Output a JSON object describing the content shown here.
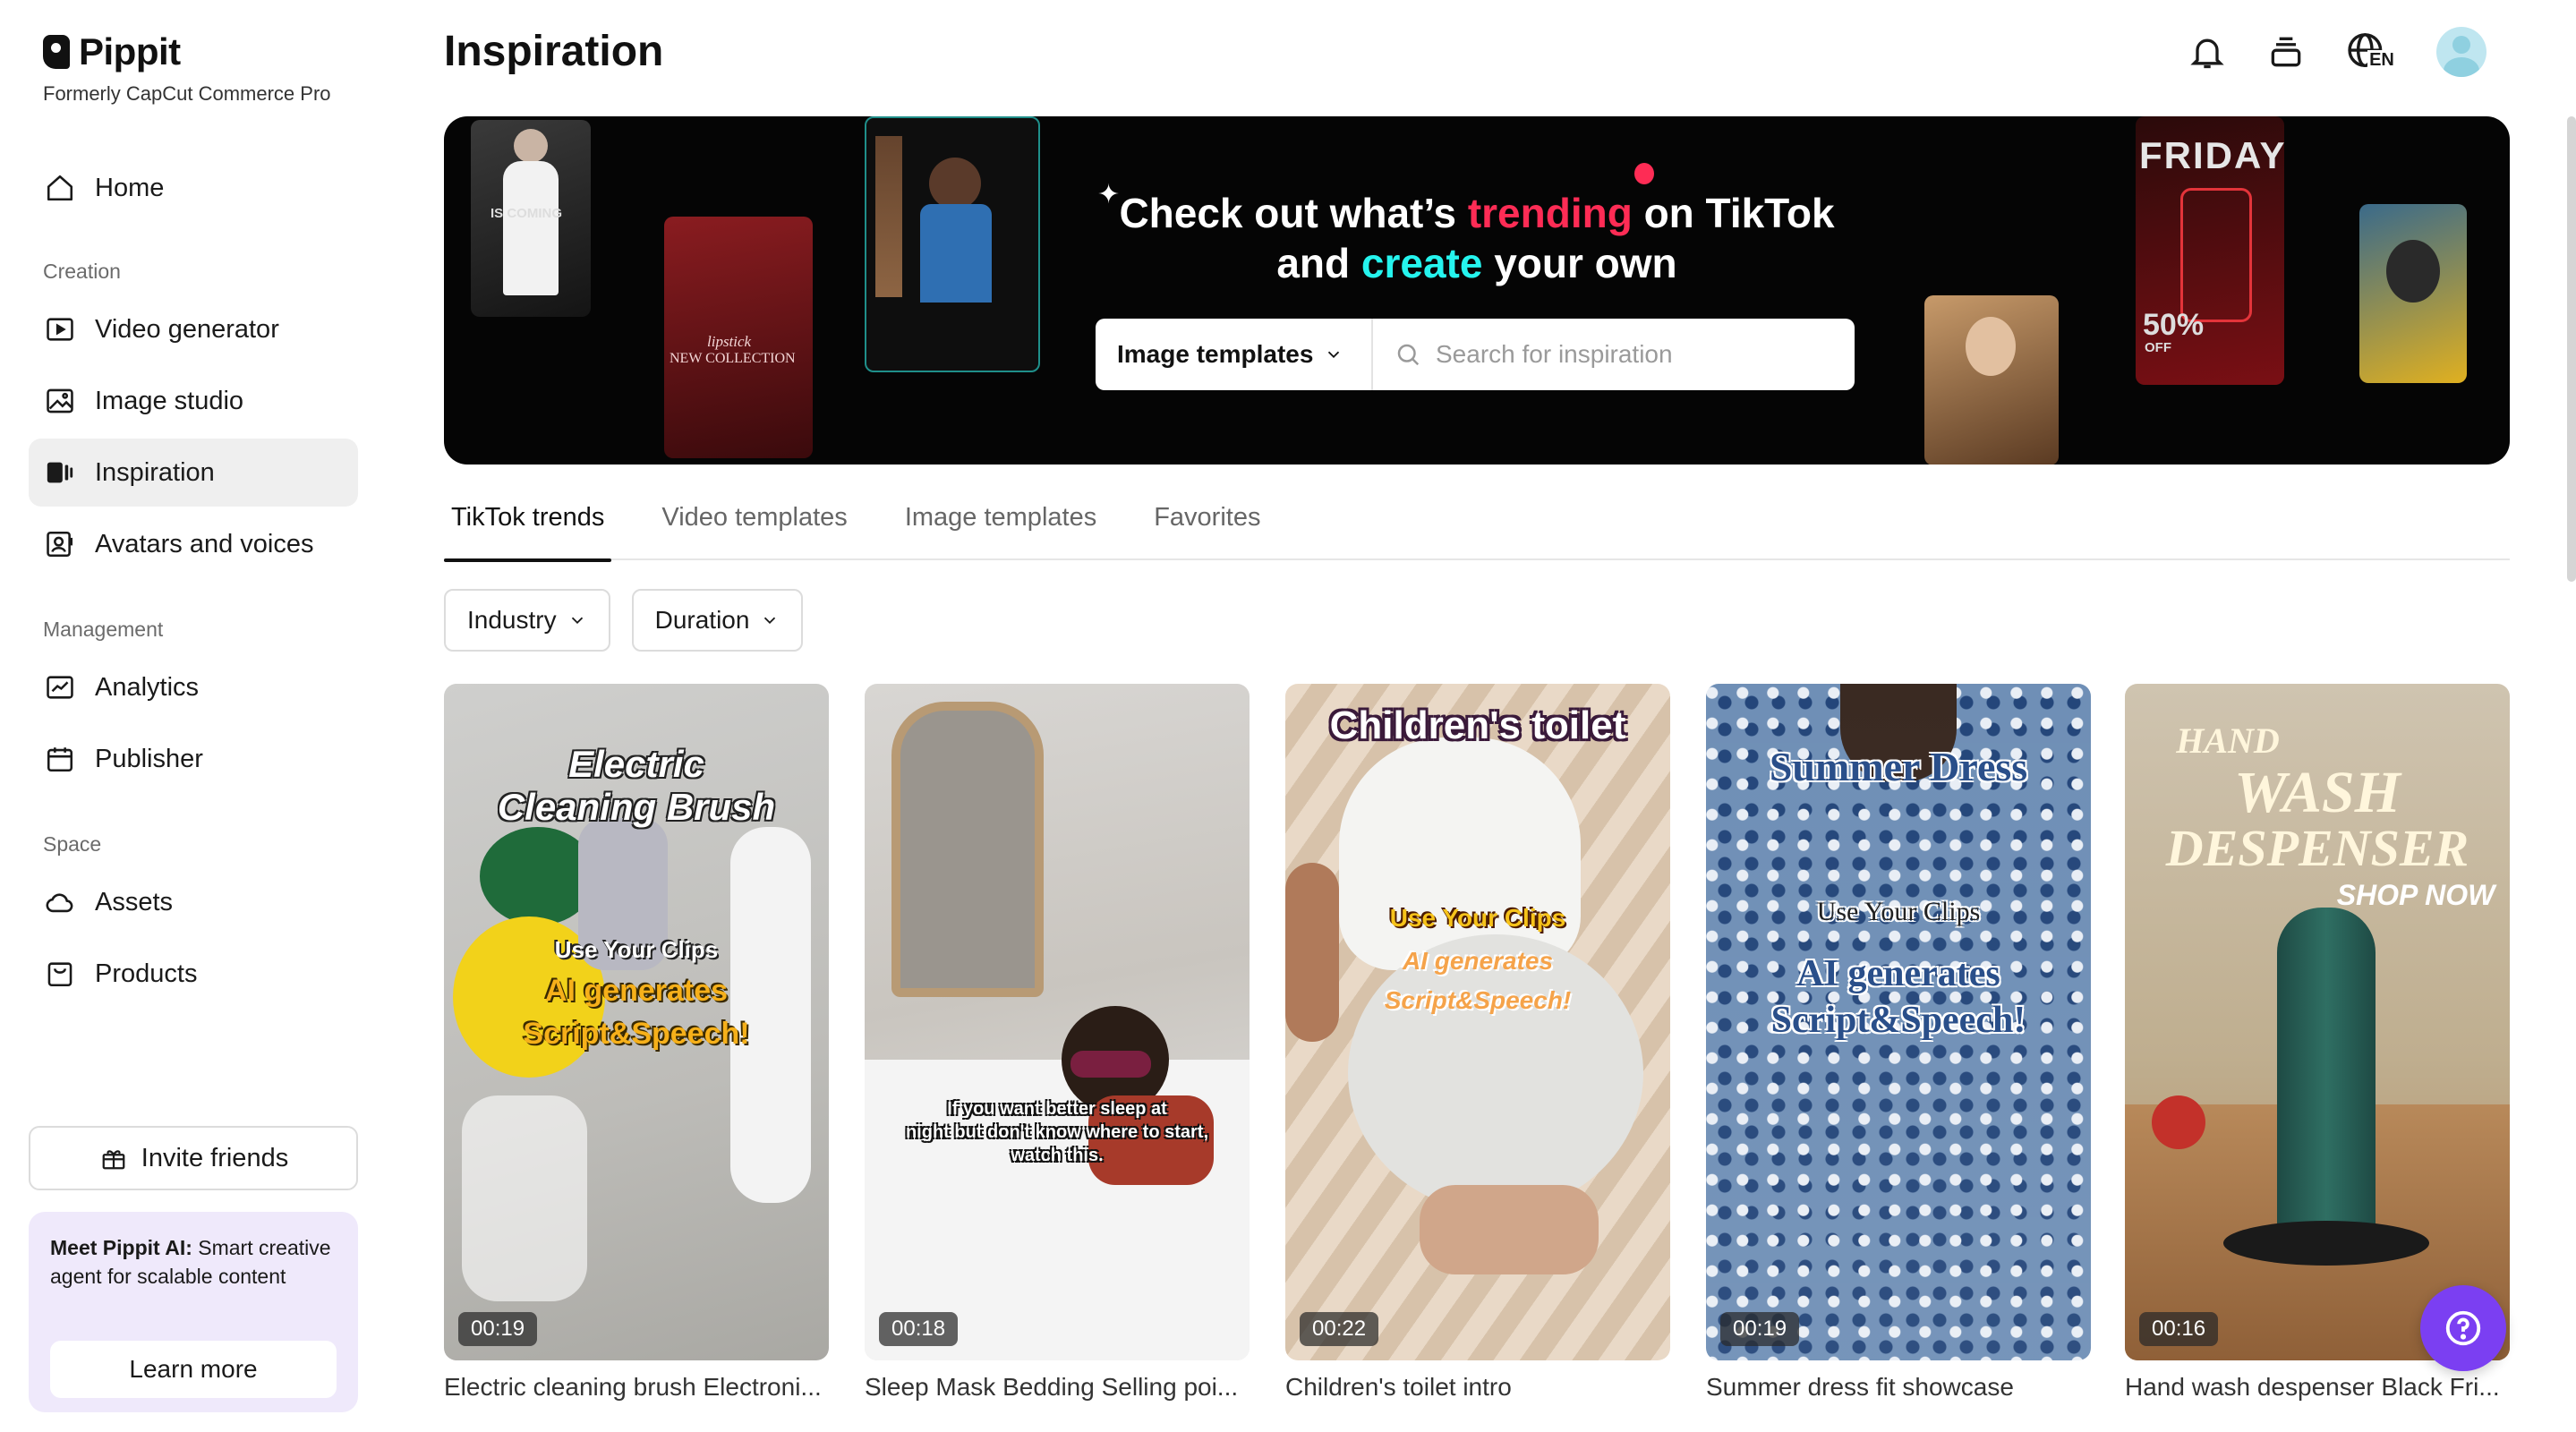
{
  "app": {
    "name": "Pippit",
    "subtitle": "Formerly CapCut Commerce Pro"
  },
  "sidebar": {
    "home": "Home",
    "sections": {
      "creation": "Creation",
      "management": "Management",
      "space": "Space"
    },
    "creation_items": [
      {
        "label": "Video generator",
        "icon": "video-generator-icon"
      },
      {
        "label": "Image studio",
        "icon": "image-studio-icon"
      },
      {
        "label": "Inspiration",
        "icon": "inspiration-icon",
        "active": true
      },
      {
        "label": "Avatars and voices",
        "icon": "avatar-icon"
      }
    ],
    "management_items": [
      {
        "label": "Analytics",
        "icon": "analytics-icon"
      },
      {
        "label": "Publisher",
        "icon": "calendar-icon"
      }
    ],
    "space_items": [
      {
        "label": "Assets",
        "icon": "cloud-icon"
      },
      {
        "label": "Products",
        "icon": "bag-icon"
      }
    ],
    "invite": "Invite friends",
    "promo": {
      "bold": "Meet Pippit AI:",
      "text": " Smart creative agent for scalable content",
      "button": "Learn more"
    }
  },
  "header": {
    "title": "Inspiration",
    "lang": "EN",
    "icons": [
      "bell-icon",
      "stack-icon",
      "globe-icon",
      "avatar"
    ]
  },
  "hero": {
    "line1_pre": "Check out what’s ",
    "line1_accent": "trending",
    "line1_post": " on TikTok",
    "line2_pre": "and ",
    "line2_accent": "create",
    "line2_post": " your own",
    "select_value": "Image templates",
    "search_placeholder": "Search for inspiration",
    "thumb_texts": {
      "coming": "IS COMING",
      "lipstick": "lipstick",
      "collection": "NEW COLLECTION",
      "friday": "FRIDAY",
      "sale": "50%",
      "off": "OFF"
    },
    "colors": {
      "pink": "#fe2c55",
      "cyan": "#25f4ee"
    }
  },
  "tabs": [
    {
      "label": "TikTok trends",
      "active": true
    },
    {
      "label": "Video templates"
    },
    {
      "label": "Image templates"
    },
    {
      "label": "Favorites"
    }
  ],
  "filters": [
    {
      "label": "Industry"
    },
    {
      "label": "Duration"
    }
  ],
  "cards": [
    {
      "duration": "00:19",
      "title": "Electric cleaning brush Electroni...",
      "overlay": [
        "Electric",
        "Cleaning Brush",
        "Use Your Clips",
        "AI generates",
        "Script&Speech!"
      ]
    },
    {
      "duration": "00:18",
      "title": "Sleep Mask Bedding Selling poi...",
      "overlay": [
        "If you want better sleep at",
        "night but don't know where to start,",
        "watch this."
      ]
    },
    {
      "duration": "00:22",
      "title": "Children's toilet intro",
      "overlay": [
        "Children's toilet",
        "Use Your Clips",
        "AI generates",
        "Script&Speech!"
      ]
    },
    {
      "duration": "00:19",
      "title": "Summer dress fit showcase",
      "overlay": [
        "Summer Dress",
        "Use Your Clips",
        "AI generates",
        "Script&Speech!"
      ]
    },
    {
      "duration": "00:16",
      "title": "Hand wash despenser Black Fri...",
      "overlay": [
        "HAND",
        "WASH",
        "DESPENSER",
        "SHOP NOW"
      ]
    }
  ]
}
